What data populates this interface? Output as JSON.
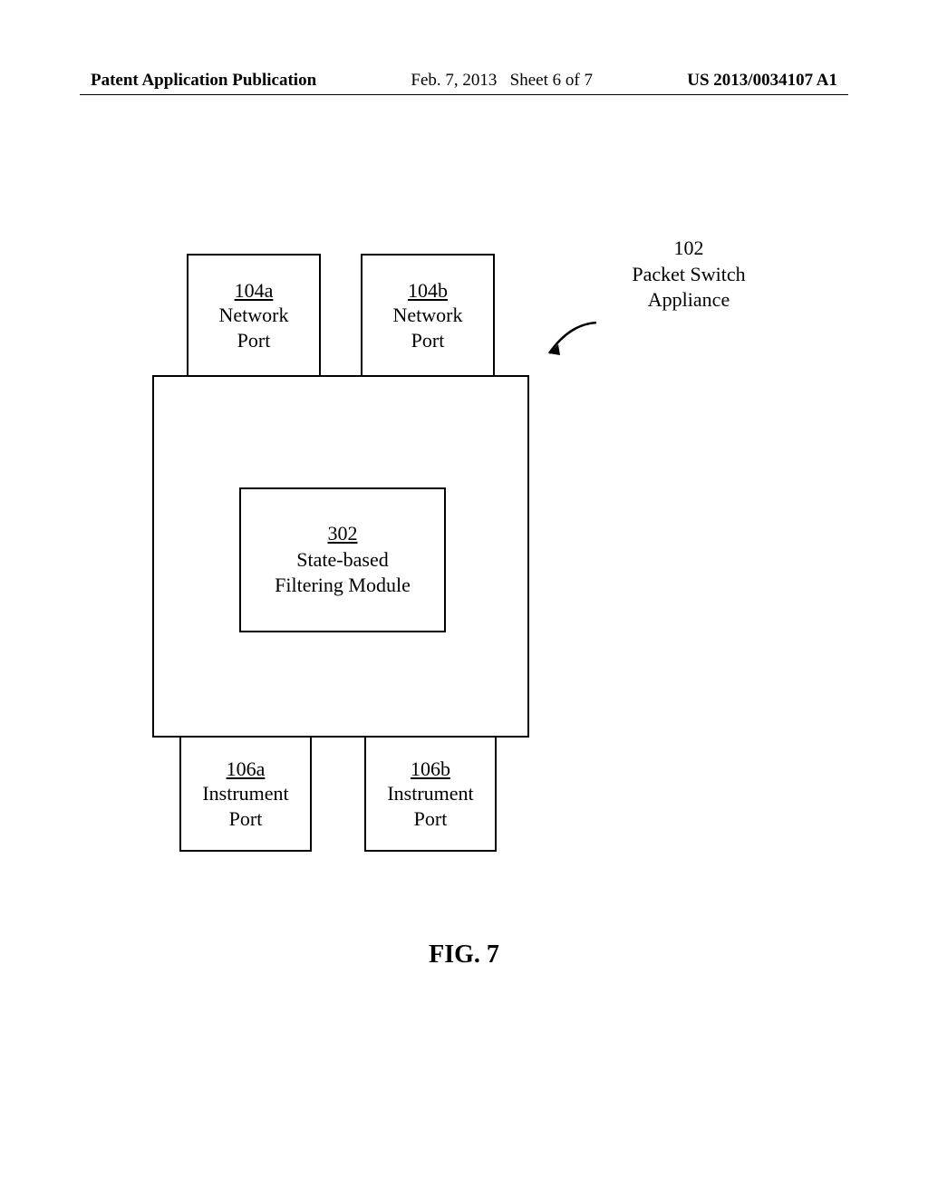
{
  "header": {
    "left": "Patent Application Publication",
    "mid_date": "Feb. 7, 2013",
    "mid_sheet": "Sheet 6 of 7",
    "right": "US 2013/0034107 A1"
  },
  "callout": {
    "ref": "102",
    "line1": "Packet Switch",
    "line2": "Appliance"
  },
  "ports": {
    "p104a": {
      "ref": "104a",
      "line1": "Network",
      "line2": "Port"
    },
    "p104b": {
      "ref": "104b",
      "line1": "Network",
      "line2": "Port"
    },
    "p106a": {
      "ref": "106a",
      "line1": "Instrument",
      "line2": "Port"
    },
    "p106b": {
      "ref": "106b",
      "line1": "Instrument",
      "line2": "Port"
    }
  },
  "module": {
    "ref": "302",
    "line1": "State-based",
    "line2": "Filtering Module"
  },
  "figure_caption": "FIG. 7"
}
